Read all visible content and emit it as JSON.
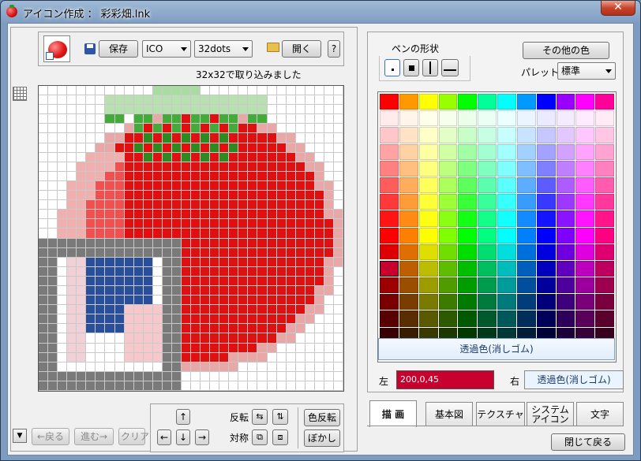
{
  "window": {
    "title": "アイコン作成 ： 彩彩畑.lnk",
    "close_label": "✕"
  },
  "toolbar": {
    "save_label": "保存",
    "format_value": "ICO",
    "size_value": "32dots",
    "open_label": "開く",
    "help_label": "?"
  },
  "status": {
    "message": "32x32で取り込みました"
  },
  "bottom": {
    "back_label": "←戻る",
    "forward_label": "進む→",
    "clear_label": "クリア",
    "flip_label": "反転",
    "symmetry_label": "対称",
    "invert_label": "色反転",
    "blur_label": "ぼかし",
    "up_arrow": "↑",
    "down_arrow": "↓",
    "left_arrow": "←",
    "right_arrow": "→",
    "menu_arrow": "▼"
  },
  "pen": {
    "section_label": "ペンの形状",
    "other_color_label": "その他の色",
    "palette_label": "パレット",
    "palette_value": "標準"
  },
  "palette": {
    "transparent_label": "透過色(消しゴム)",
    "selected_row": 10,
    "selected_col": 0
  },
  "colors": {
    "left_label": "左",
    "left_value": "200,0,45",
    "left_color": "#c8002d",
    "right_label": "右",
    "right_value": "透過色(消しゴム)"
  },
  "tabs": [
    {
      "label": "描 画"
    },
    {
      "label": "基本図"
    },
    {
      "label": "テクスチャ"
    },
    {
      "label": "システム\nアイコン"
    },
    {
      "label": "文字"
    }
  ],
  "footer": {
    "close_return_label": "閉じて戻る"
  }
}
